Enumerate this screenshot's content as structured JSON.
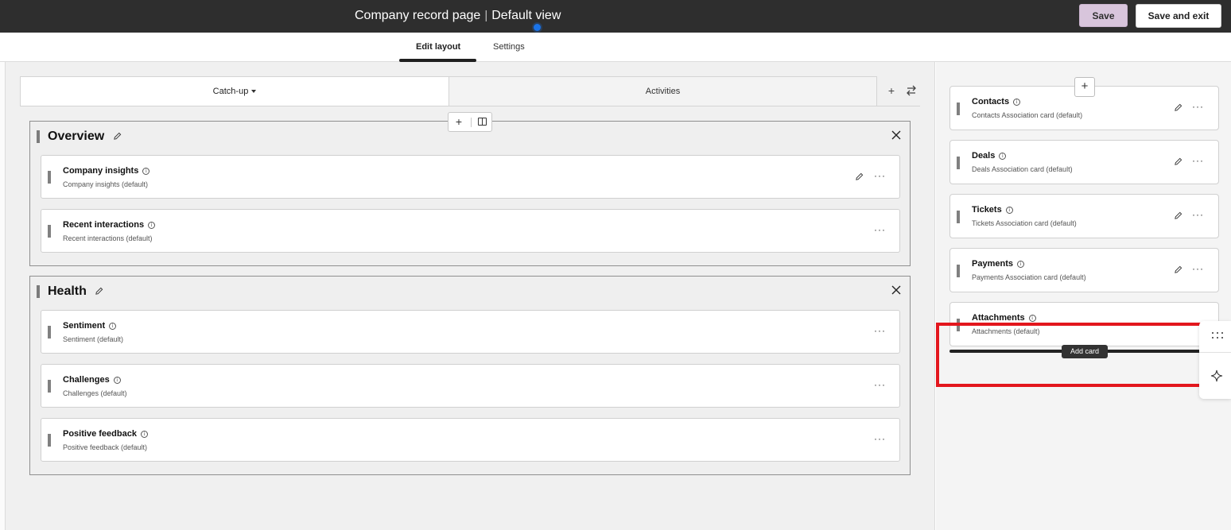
{
  "header": {
    "page_name": "Company record page",
    "separator": "|",
    "view_name": "Default view",
    "save_label": "Save",
    "save_exit_label": "Save and exit"
  },
  "page_tabs": [
    {
      "label": "Edit layout",
      "active": true
    },
    {
      "label": "Settings",
      "active": false
    }
  ],
  "sub_tabs": [
    {
      "label": "Catch-up",
      "active": true
    },
    {
      "label": "Activities",
      "active": false
    }
  ],
  "sections": [
    {
      "title": "Overview",
      "cards": [
        {
          "title": "Company insights",
          "subtitle": "Company insights (default)",
          "editable": true
        },
        {
          "title": "Recent interactions",
          "subtitle": "Recent interactions (default)",
          "editable": false
        }
      ]
    },
    {
      "title": "Health",
      "cards": [
        {
          "title": "Sentiment",
          "subtitle": "Sentiment (default)",
          "editable": false
        },
        {
          "title": "Challenges",
          "subtitle": "Challenges (default)",
          "editable": false
        },
        {
          "title": "Positive feedback",
          "subtitle": "Positive feedback (default)",
          "editable": false
        }
      ]
    }
  ],
  "sidebar_cards": [
    {
      "title": "Contacts",
      "subtitle": "Contacts Association card (default)",
      "editable": true
    },
    {
      "title": "Deals",
      "subtitle": "Deals Association card (default)",
      "editable": true
    },
    {
      "title": "Tickets",
      "subtitle": "Tickets Association card (default)",
      "editable": true
    },
    {
      "title": "Payments",
      "subtitle": "Payments Association card (default)",
      "editable": true
    },
    {
      "title": "Attachments",
      "subtitle": "Attachments (default)",
      "editable": false
    }
  ],
  "tooltip": {
    "add_card": "Add card"
  },
  "icons": {
    "info": "info-icon",
    "edit": "pencil-icon",
    "more": "more-horizontal-icon",
    "close": "close-icon",
    "drag": "drag-handle-icon",
    "add": "plus-icon",
    "swap": "swap-icon",
    "apps": "grid-icon",
    "ai": "sparkle-icon"
  },
  "colors": {
    "topbar": "#2e2e2e",
    "save_button": "#d8c5dc",
    "highlight": "#e3161d",
    "notification_dot": "#1a73e8"
  }
}
